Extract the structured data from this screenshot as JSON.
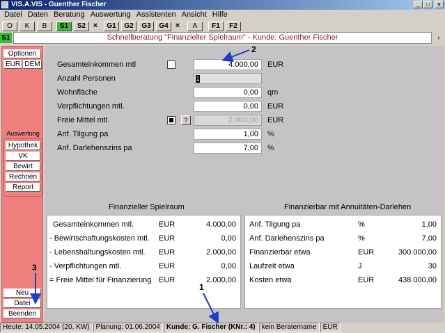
{
  "window": {
    "title": "VIS.A.VIS - Guenther Fischer",
    "minimize": "_",
    "maximize": "□",
    "close": "×"
  },
  "menu": [
    "Datei",
    "Daten",
    "Beratung",
    "Auswertung",
    "Assistenten",
    "Ansicht",
    "Hilfe"
  ],
  "toolbar": {
    "buttons": [
      "O",
      "K",
      "B",
      "S1",
      "S2",
      "×",
      "G1",
      "G2",
      "G3",
      "G4",
      "×",
      "A",
      "F1",
      "F2"
    ]
  },
  "mode": {
    "label": "S1",
    "title": "Schnellberatung \"Finanzieller Spielraum\"  -  Kunde: Guenther Fischer",
    "scroll": "›"
  },
  "sidebar": {
    "optionen": "Optionen",
    "eur": "EUR",
    "dem": "DEM",
    "auswertung_label": "Auswertung",
    "auswertung_items": [
      "Hypothek",
      "VK",
      "Bewirt",
      "Rechnen",
      "Report"
    ],
    "neu": "Neu",
    "datei": "Datei",
    "beenden": "Beenden"
  },
  "form": {
    "rows": [
      {
        "label": "Gesamteinkommen mtl",
        "value": "4.000,00",
        "unit": "EUR"
      },
      {
        "label": "Anzahl Personen",
        "value": "1",
        "unit": ""
      },
      {
        "label": "Wohnfläche",
        "value": "0,00",
        "unit": "qm"
      },
      {
        "label": "Verpflichtungen mtl.",
        "value": "0,00",
        "unit": "EUR"
      },
      {
        "label": "Freie Mittel mtl.",
        "value": "2.000,00",
        "unit": "EUR",
        "help": "?"
      },
      {
        "label": "Anf. Tilgung pa",
        "value": "1,00",
        "unit": "%"
      },
      {
        "label": "Anf. Darlehenszins pa",
        "value": "7,00",
        "unit": "%"
      }
    ]
  },
  "left_panel": {
    "title": "Finanzieller Spielraum",
    "rows": [
      {
        "label": "Gesamteinkommen mtl.",
        "currency": "EUR",
        "value": "4.000,00"
      },
      {
        "label": "- Bewirtschaftungskosten mtl.",
        "currency": "EUR",
        "value": "0,00"
      },
      {
        "label": "- Lebenshaltungskosten mtl.",
        "currency": "EUR",
        "value": "2.000,00"
      },
      {
        "label": "- Verpflichtungen mtl.",
        "currency": "EUR",
        "value": "0,00"
      },
      {
        "label": "= Freie Mittel für Finanzierung",
        "currency": "EUR",
        "value": "2.000,00"
      }
    ]
  },
  "right_panel": {
    "title": "Finanzierbar mit Annuitäten-Darlehen",
    "rows": [
      {
        "label": "Anf. Tilgung pa",
        "unit": "%",
        "value": "1,00"
      },
      {
        "label": "Anf. Darlehenszins pa",
        "unit": "%",
        "value": "7,00"
      },
      {
        "label": "Finanzierbar etwa",
        "unit": "EUR",
        "value": "300.000,00"
      },
      {
        "label": "Laufzeit etwa",
        "unit": "J",
        "value": "30"
      },
      {
        "label": "Kosten etwa",
        "unit": "EUR",
        "value": "438.000,00"
      }
    ]
  },
  "status": {
    "heute": "Heute: 14.05.2004 (20. KW)",
    "planung": "Planung: 01.06.2004",
    "kunde": "Kunde: G. Fischer (KNr.: 4)",
    "berater": "kein Beratername",
    "currency": "EUR"
  },
  "annotations": [
    "1",
    "2",
    "3"
  ],
  "colors": {
    "sidebar": "#f08080",
    "accent_green": "#3cb83c",
    "title_red": "#8b1a1a",
    "arrow_blue": "#1e3cc8"
  }
}
